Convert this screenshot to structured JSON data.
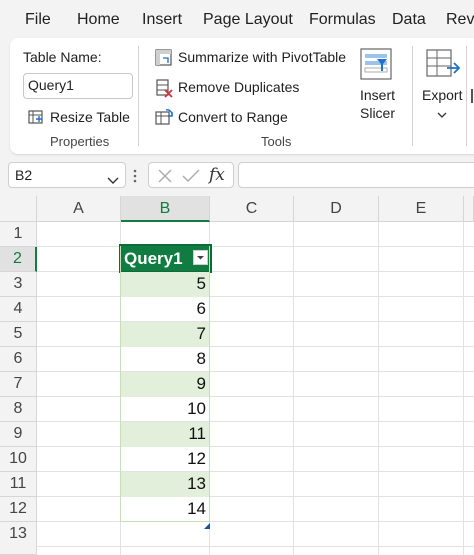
{
  "menu": {
    "items": [
      "File",
      "Home",
      "Insert",
      "Page Layout",
      "Formulas",
      "Data",
      "Revi"
    ]
  },
  "ribbon": {
    "properties": {
      "table_name_label": "Table Name:",
      "table_name_value": "Query1",
      "resize_table": "Resize Table",
      "group_title": "Properties"
    },
    "tools": {
      "summarize_pivot": "Summarize with PivotTable",
      "remove_duplicates": "Remove Duplicates",
      "convert_to_range": "Convert to Range",
      "insert_slicer_line1": "Insert",
      "insert_slicer_line2": "Slicer",
      "group_title": "Tools"
    },
    "external": {
      "export_label": "Export"
    }
  },
  "formula_bar": {
    "name_box": "B2",
    "fx_label": "fx",
    "formula": ""
  },
  "sheet": {
    "columns": [
      "A",
      "B",
      "C",
      "D",
      "E"
    ],
    "selected_column": "B",
    "rows": [
      "1",
      "2",
      "3",
      "4",
      "5",
      "6",
      "7",
      "8",
      "9",
      "10",
      "11",
      "12",
      "13"
    ],
    "selected_row": "2",
    "table": {
      "header": "Query1",
      "values": [
        "5",
        "6",
        "7",
        "8",
        "9",
        "10",
        "11",
        "12",
        "13",
        "14"
      ]
    }
  },
  "colors": {
    "accent": "#107c41",
    "band": "#e2efda"
  }
}
